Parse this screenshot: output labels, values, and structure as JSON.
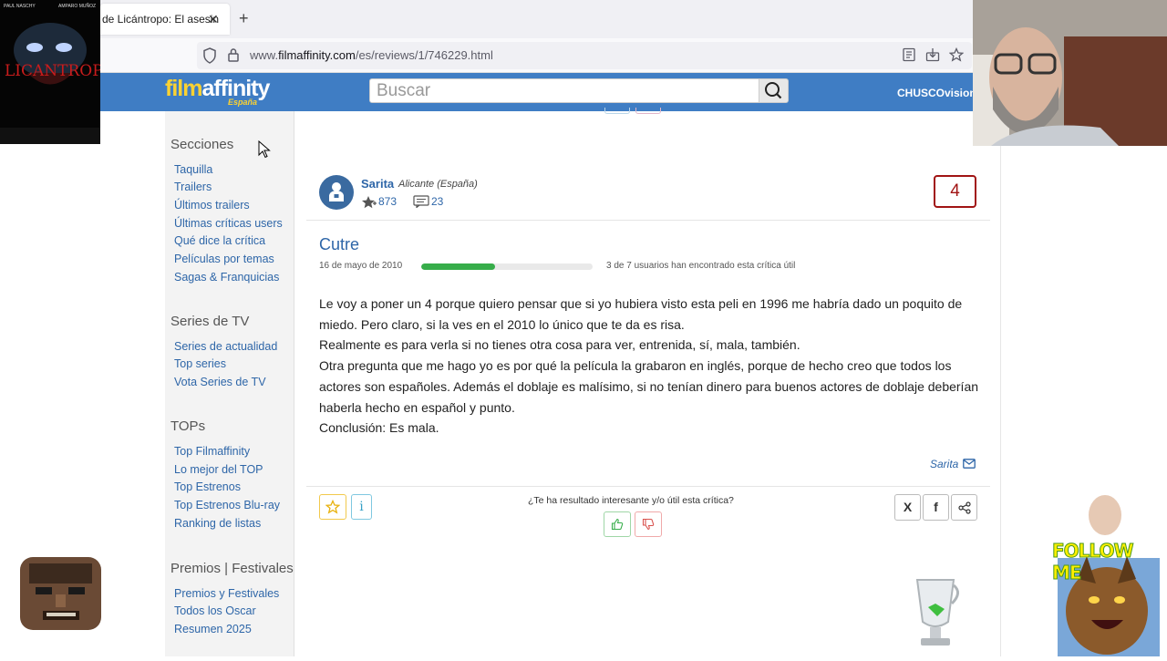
{
  "browser": {
    "tab_title": "de Licántropo: El asesin",
    "tab_close": "✕",
    "new_tab": "+",
    "url_prefix": "www.",
    "url_domain": "filmaffinity.com",
    "url_path": "/es/reviews/1/746229.html"
  },
  "site": {
    "logo_film": "film",
    "logo_affinity": "affinity",
    "logo_sub": "España",
    "search_placeholder": "Buscar",
    "user": "CHUSCOvision"
  },
  "sidebar": {
    "sections": [
      {
        "title": "Secciones",
        "links": [
          "Taquilla",
          "Trailers",
          "Últimos trailers",
          "Últimas críticas users",
          "Qué dice la crítica",
          "Películas por temas",
          "Sagas & Franquicias"
        ]
      },
      {
        "title": "Series de TV",
        "links": [
          "Series de actualidad",
          "Top series",
          "Vota Series de TV"
        ]
      },
      {
        "title": "TOPs",
        "links": [
          "Top Filmaffinity",
          "Lo mejor del TOP",
          "Top Estrenos",
          "Top Estrenos Blu-ray",
          "Ranking de listas"
        ]
      },
      {
        "title": "Premios | Festivales",
        "links": [
          "Premios y Festivales",
          "Todos los Oscar",
          "Resumen 2025"
        ]
      }
    ]
  },
  "review": {
    "author": "Sarita",
    "location": "Alicante (España)",
    "ratings_count": "873",
    "reviews_count": "23",
    "score": "4",
    "title": "Cutre",
    "date": "16 de mayo de 2010",
    "useful_fraction": 0.43,
    "useful_text": "3 de 7 usuarios han encontrado esta crítica útil",
    "body": [
      "Le voy a poner un 4 porque quiero pensar que si yo hubiera visto esta peli en 1996 me habría dado un poquito de miedo. Pero claro, si la ves en el 2010 lo único que te da es risa.",
      "Realmente es para verla si no tienes otra cosa para ver, entrenida, sí, mala, también.",
      "Otra pregunta que me hago yo es por qué la película la grabaron en inglés, porque de hecho creo que todos los actores son españoles. Además el doblaje es malísimo, si no tenían dinero para buenos actores de doblaje deberían haberla hecho en español y punto.",
      "Conclusión: Es mala."
    ],
    "signature": "Sarita",
    "question": "¿Te ha resultado interesante y/o útil esta crítica?",
    "info_label": "i",
    "share_x": "X",
    "share_fb": "f"
  },
  "overlays": {
    "follow_text": "FOLLOW ME",
    "poster_title": "LICANTROPO",
    "poster_top_left": "PAUL NASCHY",
    "poster_top_right": "AMPARO MUÑOZ"
  },
  "colors": {
    "header_blue": "#3f7dc4",
    "link_blue": "#2e66a8",
    "score_red": "#a11414",
    "useful_green": "#37ad4a",
    "logo_yellow": "#fbd232"
  }
}
